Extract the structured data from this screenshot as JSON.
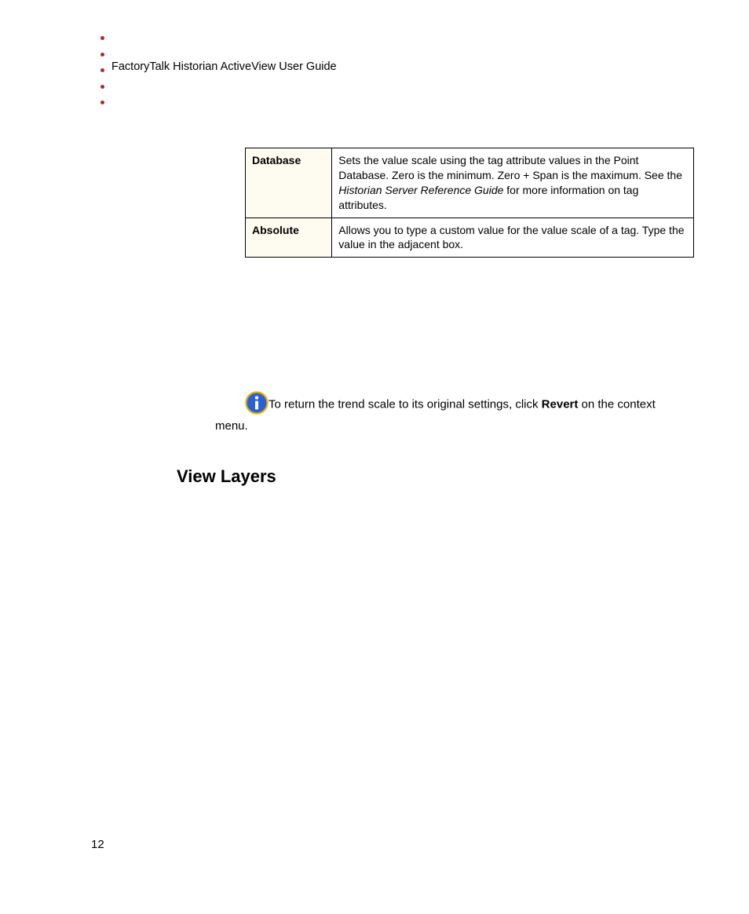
{
  "header": {
    "title": "FactoryTalk Historian ActiveView User Guide"
  },
  "table": {
    "rows": [
      {
        "label": "Database",
        "desc_pre": "Sets the value scale using the tag attribute values in the Point Database. Zero is the minimum. Zero + Span is the maximum. See the ",
        "desc_italic": "Historian Server Reference Guide",
        "desc_post": " for more information on tag attributes."
      },
      {
        "label": "Absolute",
        "desc_pre": "Allows you to type a custom value for the value scale of a tag. Type the value in the adjacent box.",
        "desc_italic": "",
        "desc_post": ""
      }
    ]
  },
  "info": {
    "pre": "To return the trend scale to its original settings, click ",
    "bold": "Revert",
    "post": " on the context menu."
  },
  "section": {
    "heading": "View Layers"
  },
  "page_number": "12"
}
